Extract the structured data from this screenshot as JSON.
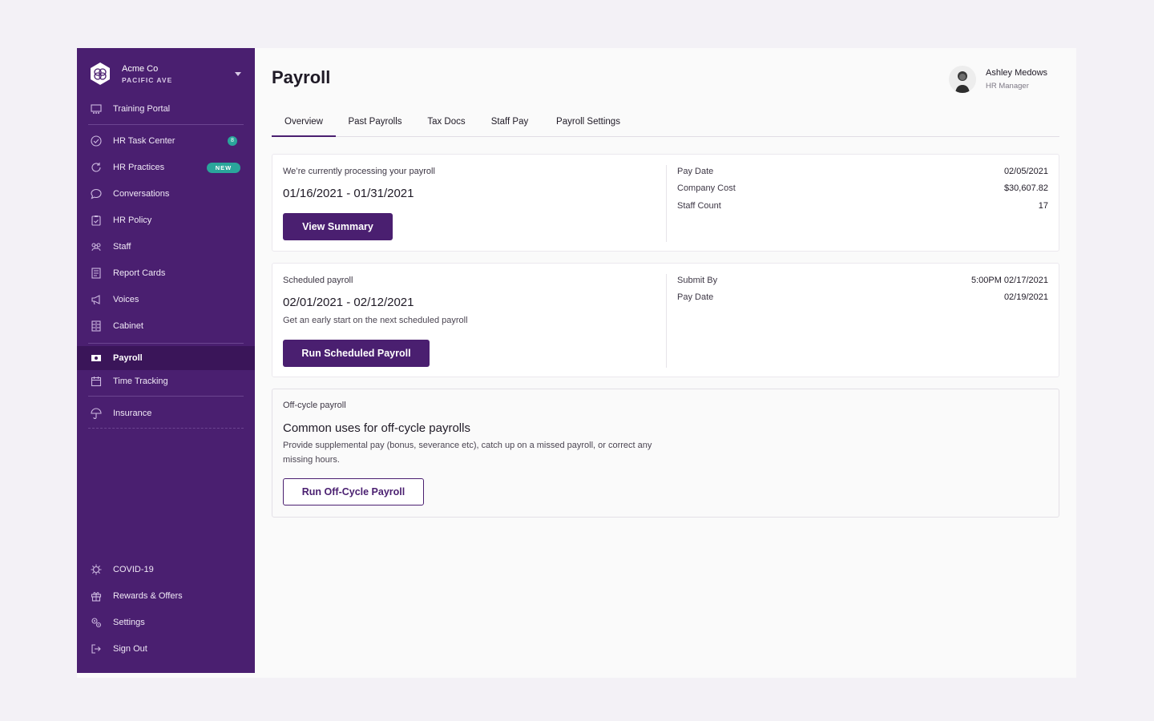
{
  "company": {
    "name": "Acme Co",
    "location": "PACIFIC AVE"
  },
  "sidebar": {
    "items": [
      {
        "label": "Training Portal"
      },
      {
        "label": "HR Task Center",
        "badge": "8"
      },
      {
        "label": "HR Practices",
        "badge": "NEW"
      },
      {
        "label": "Conversations"
      },
      {
        "label": "HR Policy"
      },
      {
        "label": "Staff"
      },
      {
        "label": "Report Cards"
      },
      {
        "label": "Voices"
      },
      {
        "label": "Cabinet"
      },
      {
        "label": "Payroll"
      },
      {
        "label": "Time Tracking"
      },
      {
        "label": "Insurance"
      }
    ],
    "bottom_items": [
      {
        "label": "COVID-19"
      },
      {
        "label": "Rewards & Offers"
      },
      {
        "label": "Settings"
      },
      {
        "label": "Sign Out"
      }
    ]
  },
  "header": {
    "title": "Payroll"
  },
  "user": {
    "name": "Ashley Medows",
    "role": "HR Manager"
  },
  "tabs": [
    {
      "label": "Overview"
    },
    {
      "label": "Past Payrolls"
    },
    {
      "label": "Tax Docs"
    },
    {
      "label": "Staff Pay"
    },
    {
      "label": "Payroll Settings"
    }
  ],
  "current": {
    "label": "We’re currently processing your payroll",
    "range": "01/16/2021 - 01/31/2021",
    "button": "View Summary",
    "details": [
      {
        "label": "Pay Date",
        "value": "02/05/2021"
      },
      {
        "label": "Company Cost",
        "value": "$30,607.82"
      },
      {
        "label": "Staff Count",
        "value": "17"
      }
    ]
  },
  "scheduled": {
    "label": "Scheduled payroll",
    "range": "02/01/2021 - 02/12/2021",
    "description": "Get an early start on the next scheduled payroll",
    "button": "Run Scheduled Payroll",
    "details": [
      {
        "label": "Submit By",
        "value": "5:00PM 02/17/2021"
      },
      {
        "label": "Pay Date",
        "value": "02/19/2021"
      }
    ]
  },
  "offcycle": {
    "label": "Off-cycle payroll",
    "title": "Common uses for off-cycle payrolls",
    "description": "Provide supplemental pay (bonus, severance etc), catch up on a missed payroll, or correct any missing hours.",
    "button": "Run Off-Cycle Payroll"
  },
  "colors": {
    "brand": "#4a1f70",
    "accent": "#2aa59b"
  }
}
